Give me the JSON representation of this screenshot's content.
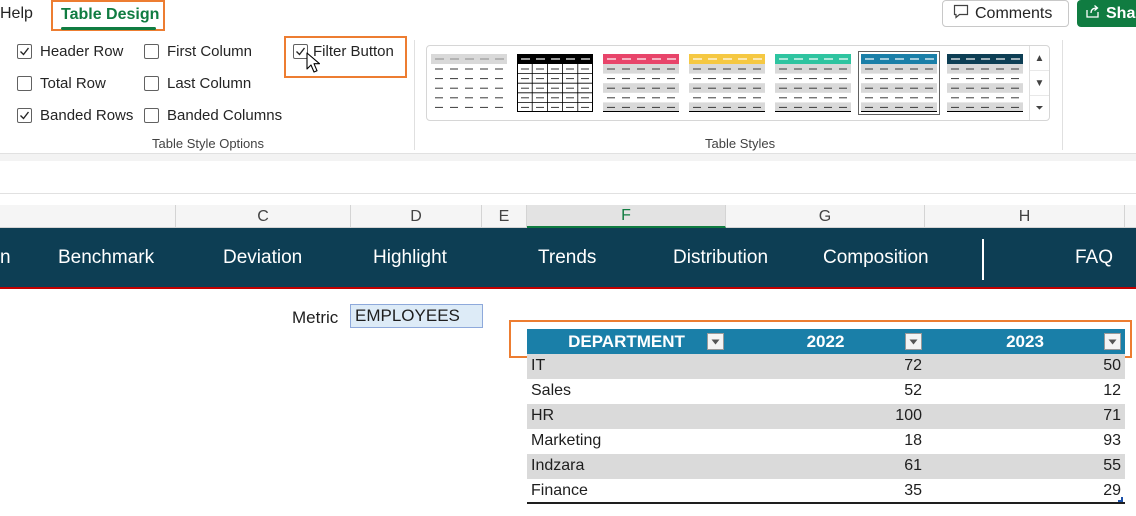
{
  "menu": {
    "help_label": "Help",
    "active_tab_label": "Table Design",
    "comments_label": "Comments",
    "share_label": "Sha"
  },
  "table_style_options": {
    "group_label": "Table Style Options",
    "options": [
      {
        "label": "Header Row",
        "checked": true
      },
      {
        "label": "Total Row",
        "checked": false
      },
      {
        "label": "Banded Rows",
        "checked": true
      },
      {
        "label": "First Column",
        "checked": false
      },
      {
        "label": "Last Column",
        "checked": false
      },
      {
        "label": "Banded Columns",
        "checked": false
      },
      {
        "label": "Filter Button",
        "checked": true
      }
    ]
  },
  "table_styles": {
    "group_label": "Table Styles",
    "swatch_header_colors": [
      "#d9d9d9",
      "#000000",
      "#e8446a",
      "#f5c842",
      "#2ec4a0",
      "#1a7fa8",
      "#0d3e54"
    ],
    "selected_index": 5
  },
  "columns": {
    "headers": [
      "C",
      "D",
      "E",
      "F",
      "G",
      "H"
    ],
    "active": "F"
  },
  "nav": {
    "items": [
      "n",
      "Benchmark",
      "Deviation",
      "Highlight",
      "Trends",
      "Distribution",
      "Composition",
      "FAQ"
    ],
    "band_color": "#0d3e54"
  },
  "metric": {
    "label": "Metric",
    "value": "EMPLOYEES"
  },
  "table": {
    "header_color": "#1a7fa8",
    "headers": [
      "DEPARTMENT",
      "2022",
      "2023"
    ],
    "rows": [
      {
        "name": "IT",
        "v2022": "72",
        "v2023": "50"
      },
      {
        "name": "Sales",
        "v2022": "52",
        "v2023": "12"
      },
      {
        "name": "HR",
        "v2022": "100",
        "v2023": "71"
      },
      {
        "name": "Marketing",
        "v2022": "18",
        "v2023": "93"
      },
      {
        "name": "Indzara",
        "v2022": "61",
        "v2023": "55"
      },
      {
        "name": "Finance",
        "v2022": "35",
        "v2023": "29"
      }
    ]
  },
  "accent": {
    "highlight": "#ed7d31",
    "excel_green": "#107c41"
  }
}
